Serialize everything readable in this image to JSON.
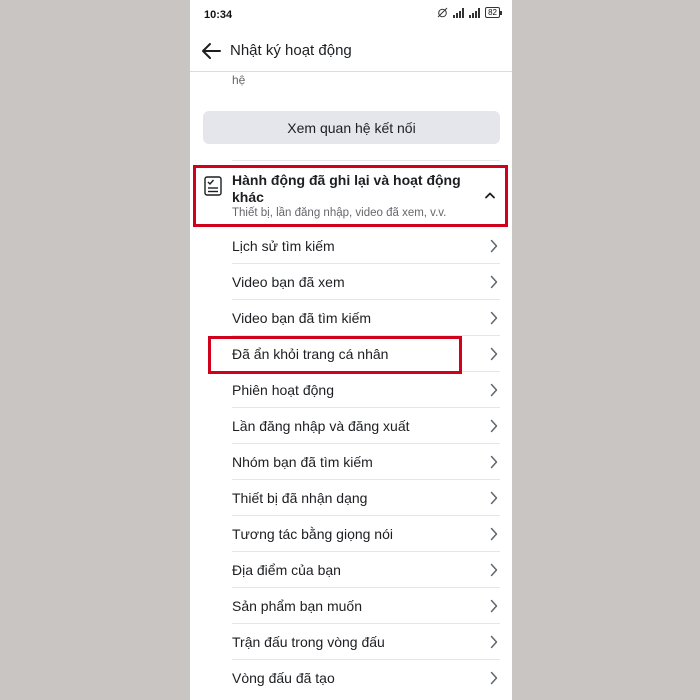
{
  "status_bar": {
    "time": "10:34",
    "battery": "82"
  },
  "header": {
    "title": "Nhật ký hoạt động"
  },
  "truncated_text": "hệ",
  "connect_button_label": "Xem quan hệ kết nối",
  "section": {
    "title": "Hành động đã ghi lại và hoạt động khác",
    "subtitle": "Thiết bị, lần đăng nhập, video đã xem, v.v."
  },
  "menu_items": [
    {
      "label": "Lịch sử tìm kiếm"
    },
    {
      "label": "Video bạn đã xem"
    },
    {
      "label": "Video bạn đã tìm kiếm"
    },
    {
      "label": "Đã ẩn khỏi trang cá nhân"
    },
    {
      "label": "Phiên hoạt động"
    },
    {
      "label": "Lần đăng nhập và đăng xuất"
    },
    {
      "label": "Nhóm bạn đã tìm kiếm"
    },
    {
      "label": "Thiết bị đã nhận dạng"
    },
    {
      "label": "Tương tác bằng giọng nói"
    },
    {
      "label": "Địa điểm của bạn"
    },
    {
      "label": "Sản phẩm bạn muốn"
    },
    {
      "label": "Trận đấu trong vòng đấu"
    },
    {
      "label": "Vòng đấu đã tạo"
    }
  ],
  "colors": {
    "highlight": "#d0021b",
    "background": "#c9c5c3"
  }
}
